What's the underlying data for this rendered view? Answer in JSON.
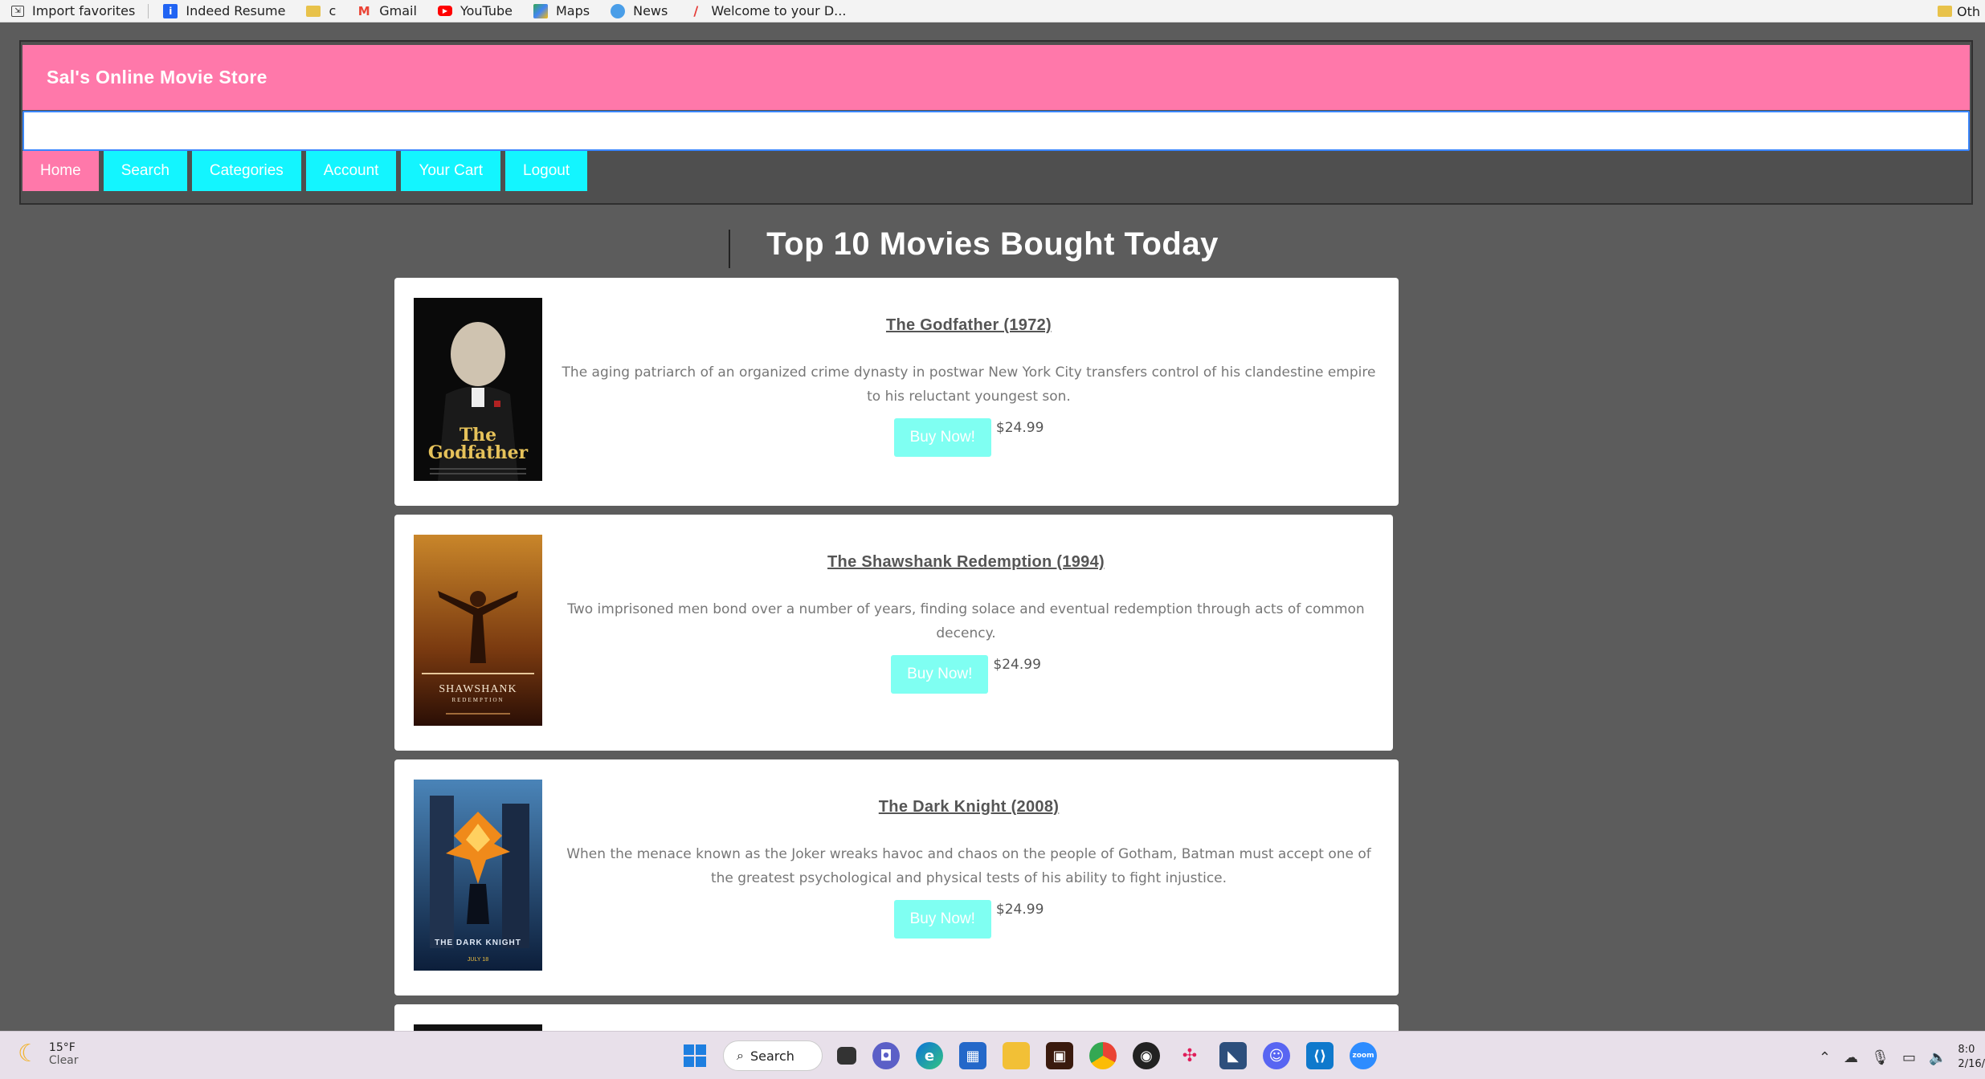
{
  "bookmarks": {
    "items": [
      {
        "label": "Import favorites",
        "icon": "import-icon",
        "color": "#555555"
      },
      {
        "label": "Indeed Resume",
        "icon": "indeed-icon",
        "color": "#2164f3"
      },
      {
        "label": "c",
        "icon": "folder-icon",
        "color": "#e8c24a"
      },
      {
        "label": "Gmail",
        "icon": "gmail-icon",
        "color": "#ea4335"
      },
      {
        "label": "YouTube",
        "icon": "youtube-icon",
        "color": "#ff0000"
      },
      {
        "label": "Maps",
        "icon": "maps-icon",
        "color": "#34a853"
      },
      {
        "label": "News",
        "icon": "news-icon",
        "color": "#4a9ee8"
      },
      {
        "label": "Welcome to your D...",
        "icon": "slash-icon",
        "color": "#e53935"
      }
    ],
    "other_label": "Oth"
  },
  "site": {
    "title": "Sal's Online Movie Store",
    "search_value": "",
    "nav": [
      "Home",
      "Search",
      "Categories",
      "Account",
      "Your Cart",
      "Logout"
    ],
    "colors": {
      "banner": "#ff78aa",
      "nav": "#13f5ff",
      "buy": "#7ffff2",
      "background": "#5c5c5c"
    }
  },
  "main": {
    "heading": "Top 10 Movies Bought Today",
    "movies": [
      {
        "title": "The Godfather (1972)",
        "description": "The aging patriarch of an organized crime dynasty in postwar New York City transfers control of his clandestine empire to his reluctant youngest son.",
        "buy_label": "Buy Now!",
        "price": "$24.99",
        "poster_text": "The Godfather"
      },
      {
        "title": "The Shawshank Redemption (1994)",
        "description": "Two imprisoned men bond over a number of years, finding solace and eventual redemption through acts of common decency.",
        "buy_label": "Buy Now!",
        "price": "$24.99",
        "poster_text": "SHAWSHANK"
      },
      {
        "title": "The Dark Knight (2008)",
        "description": "When the menace known as the Joker wreaks havoc and chaos on the people of Gotham, Batman must accept one of the greatest psychological and physical tests of his ability to fight injustice.",
        "buy_label": "Buy Now!",
        "price": "$24.99",
        "poster_text": "THE DARK KNIGHT"
      }
    ]
  },
  "taskbar": {
    "weather_temp": "15°F",
    "weather_desc": "Clear",
    "search_label": "Search",
    "clock_time": "8:0",
    "clock_date": "2/16/"
  }
}
